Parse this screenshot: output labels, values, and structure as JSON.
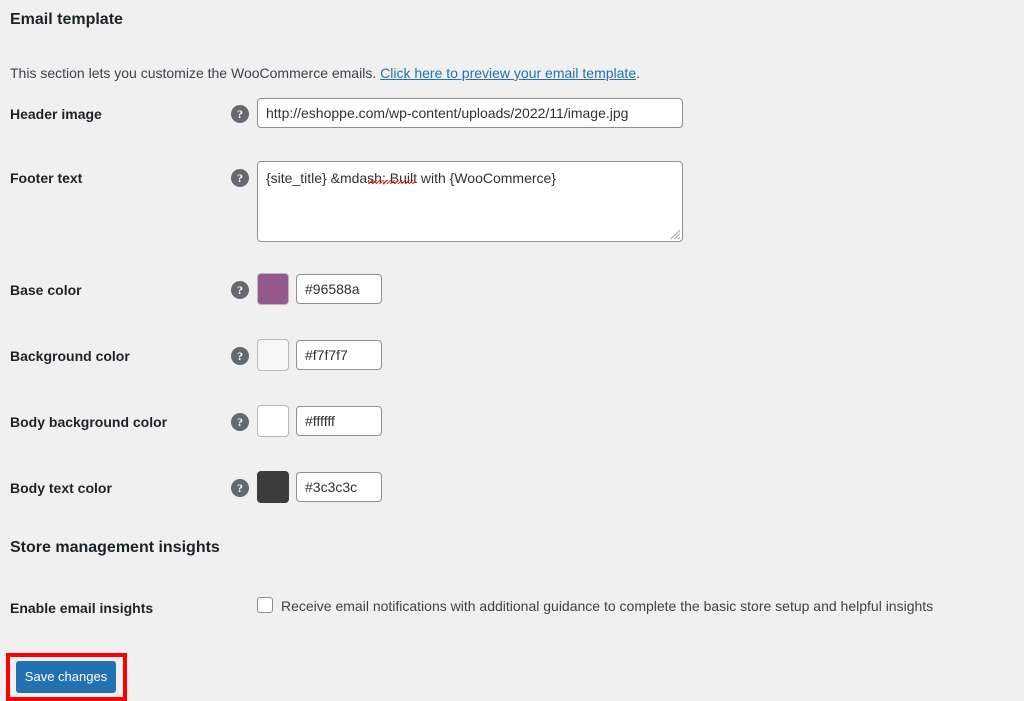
{
  "colors": {
    "page_background": "#f0f0f1",
    "link": "#2271b1",
    "primary_button": "#2271b1",
    "annotation_highlight": "#ff0000",
    "help_icon": "#646970"
  },
  "email_template": {
    "title": "Email template",
    "description_before_link": "This section lets you customize the WooCommerce emails. ",
    "link_text": "Click here to preview your email template",
    "description_after_link": ".",
    "fields": {
      "header_image": {
        "label": "Header image",
        "help_icon": "help-icon",
        "value": "http://eshoppe.com/wp-content/uploads/2022/11/image.jpg"
      },
      "footer_text": {
        "label": "Footer text",
        "help_icon": "help-icon",
        "value": "{site_title} &mdash; Built with {WooCommerce}"
      },
      "base_color": {
        "label": "Base color",
        "help_icon": "help-icon",
        "swatch": "#96588a",
        "value": "#96588a"
      },
      "background_color": {
        "label": "Background color",
        "help_icon": "help-icon",
        "swatch": "#f7f7f7",
        "value": "#f7f7f7"
      },
      "body_background_color": {
        "label": "Body background color",
        "help_icon": "help-icon",
        "swatch": "#ffffff",
        "value": "#ffffff"
      },
      "body_text_color": {
        "label": "Body text color",
        "help_icon": "help-icon",
        "swatch": "#3c3c3c",
        "value": "#3c3c3c"
      }
    }
  },
  "store_management_insights": {
    "title": "Store management insights",
    "enable_email_insights": {
      "label": "Enable email insights",
      "checkbox_label": "Receive email notifications with additional guidance to complete the basic store setup and helpful insights",
      "checked": false
    }
  },
  "footer_actions": {
    "save_label": "Save changes"
  }
}
